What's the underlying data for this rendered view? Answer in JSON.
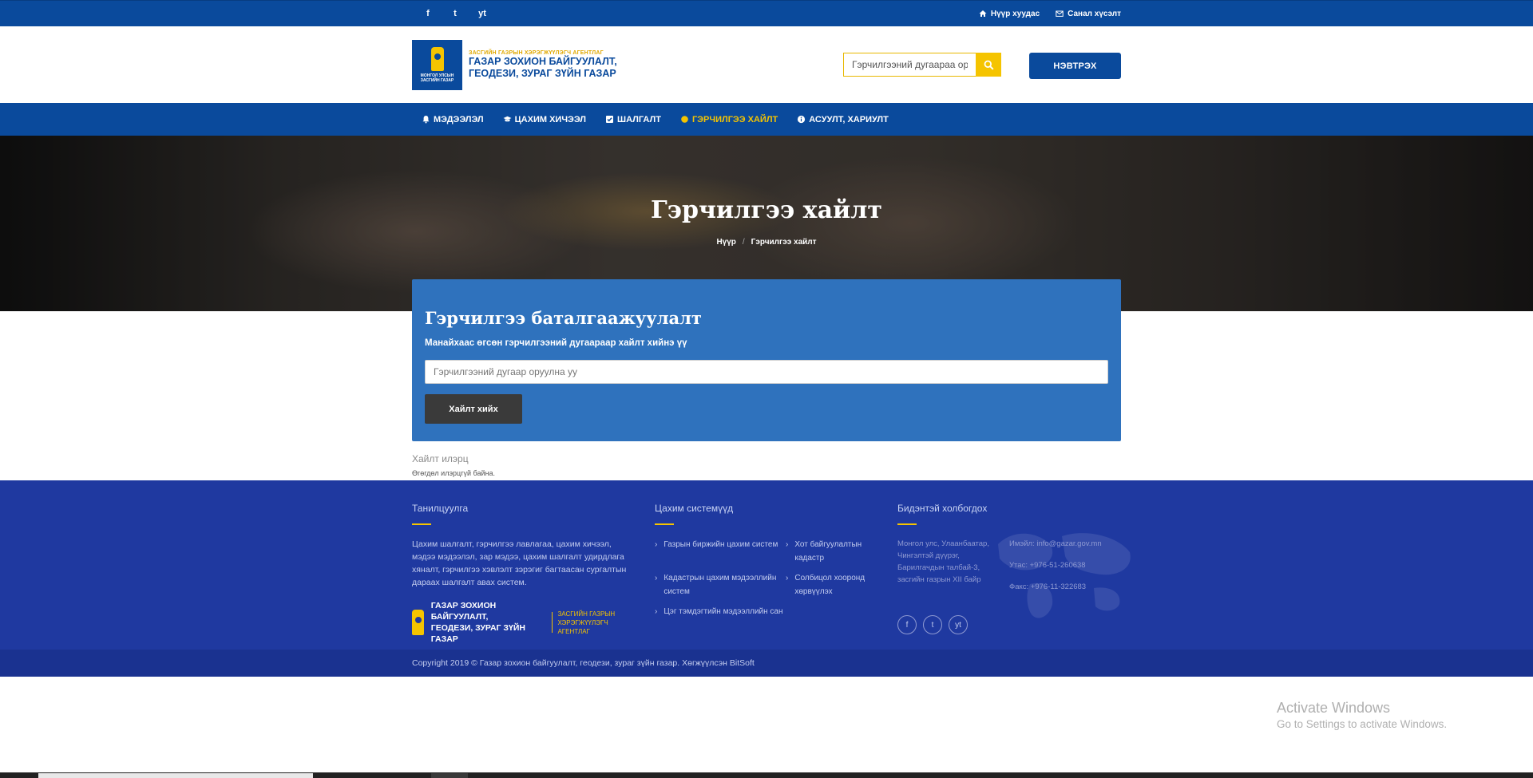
{
  "topbar": {
    "social": [
      "f",
      "t",
      "yt"
    ],
    "home_label": "Нүүр хуудас",
    "feedback_label": "Санал хүсэлт"
  },
  "header": {
    "logo_sup": "ЗАСГИЙН ГАЗРЫН ХЭРЭГЖҮҮЛЭГЧ АГЕНТЛАГ",
    "logo_line1": "ГАЗАР ЗОХИОН БАЙГУУЛАЛТ,",
    "logo_line2": "ГЕОДЕЗИ, ЗУРАГ ЗҮЙН ГАЗАР",
    "emblem_line1": "МОНГОЛ УЛСЫН",
    "emblem_line2": "ЗАСГИЙН ГАЗАР",
    "search_value": "Гэрчилгээний дугаараа оруулна уу",
    "login_label": "НЭВТРЭХ"
  },
  "nav": {
    "items": [
      {
        "label": "МЭДЭЭЛЭЛ",
        "icon": "bell-icon"
      },
      {
        "label": "ЦАХИМ ХИЧЭЭЛ",
        "icon": "graduation-cap-icon"
      },
      {
        "label": "ШАЛГАЛТ",
        "icon": "checkbox-icon"
      },
      {
        "label": "ГЭРЧИЛГЭЭ ХАЙЛТ",
        "icon": "circle-icon",
        "active": true
      },
      {
        "label": "АСУУЛТ, ХАРИУЛТ",
        "icon": "info-icon"
      }
    ]
  },
  "hero": {
    "title": "Гэрчилгээ хайлт",
    "breadcrumb": [
      "Нүүр",
      "Гэрчилгээ хайлт"
    ]
  },
  "verify": {
    "title": "Гэрчилгээ баталгаажуулалт",
    "description": "Манайхаас өгсөн гэрчилгээний дугаараар хайлт хийнэ үү",
    "placeholder": "Гэрчилгээний дугаар оруулна уу",
    "button_label": "Хайлт хийх"
  },
  "results": {
    "title": "Хайлт илэрц",
    "empty_text": "Өгөгдөл илэрцгүй байна."
  },
  "footer": {
    "about": {
      "heading": "Танилцуулга",
      "text": "Цахим шалгалт, гэрчилгээ лавлагаа, цахим хичээл, мэдээ мэдээлэл, зар мэдээ, цахим шалгалт удирдлага хяналт, гэрчилгээ хэвлэлт зэрэгиг багтаасан сургалтын дараах шалгалт авах систем.",
      "logo_line1": "ГАЗАР ЗОХИОН БАЙГУУЛАЛТ,",
      "logo_line2": "ГЕОДЕЗИ, ЗУРАГ ЗҮЙН ГАЗАР",
      "logo_sub1": "ЗАСГИЙН ГАЗРЫН",
      "logo_sub2": "ХЭРЭГЖҮҮЛЭГЧ АГЕНТЛАГ"
    },
    "systems": {
      "heading": "Цахим системүүд",
      "links": [
        "Газрын биржийн цахим систем",
        "Хот байгуулалтын кадастр",
        "Кадастрын цахим мэдээллийн систем",
        "Солбицол хооронд хөрвүүлэх",
        "Цэг тэмдэгтийн мэдээллийн сан"
      ]
    },
    "contact": {
      "heading": "Бидэнтэй холбогдох",
      "address": "Монгол улс, Улаанбаатар, Чингэлтэй дүүрэг, Барилгачдын талбай-3, засгийн газрын XII байр",
      "email": "Имэйл: info@gazar.gov.mn",
      "phone": "Утас: +976-51-260638",
      "fax": "Факс: +976-11-322683",
      "social": [
        "f",
        "t",
        "yt"
      ]
    },
    "copyright": "Copyright 2019 © Газар зохион байгуулалт, геодези, зураг зүйн газар. Хөгжүүлсэн BitSoft"
  },
  "watermark": {
    "line1": "Activate Windows",
    "line2": "Go to Settings to activate Windows."
  },
  "colors": {
    "primary": "#0a4a9c",
    "accent": "#f5c400",
    "card": "#2f72bd",
    "footer": "#1f39a0"
  }
}
